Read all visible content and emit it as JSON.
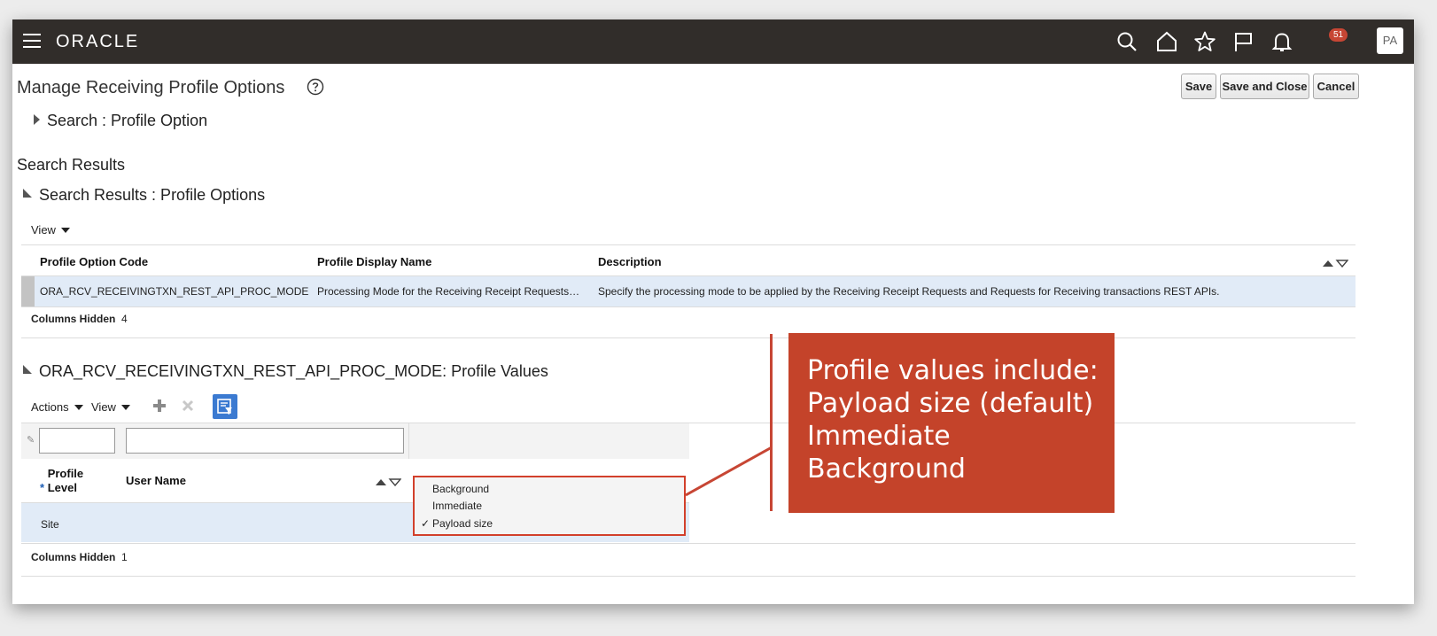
{
  "header": {
    "logo": "ORACLE",
    "notification_count": "51",
    "avatar_initials": "PA"
  },
  "page": {
    "title": "Manage Receiving Profile Options",
    "buttons": {
      "save": "Save",
      "save_close": "Save and Close",
      "cancel": "Cancel"
    },
    "search_section": "Search : Profile Option",
    "results_title": "Search Results",
    "results_subtitle": "Search Results : Profile Options"
  },
  "profile_table": {
    "view_label": "View",
    "columns": [
      "Profile Option Code",
      "Profile Display Name",
      "Description"
    ],
    "row": {
      "code": "ORA_RCV_RECEIVINGTXN_REST_API_PROC_MODE",
      "display_name": "Processing Mode for the Receiving Receipt Requests…",
      "description": "Specify the processing mode to be applied by the Receiving Receipt Requests and Requests for Receiving transactions REST APIs."
    },
    "columns_hidden_label": "Columns Hidden",
    "columns_hidden_count": "4"
  },
  "values_section": {
    "title": "ORA_RCV_RECEIVINGTXN_REST_API_PROC_MODE: Profile Values",
    "actions_label": "Actions",
    "view_label": "View",
    "columns": {
      "required_mark": "*",
      "profile_level": "Profile Level",
      "user_name": "User Name"
    },
    "row": {
      "profile_level": "Site"
    },
    "columns_hidden_label": "Columns Hidden",
    "columns_hidden_count": "1"
  },
  "dropdown": {
    "options": [
      "Background",
      "Immediate",
      "Payload size"
    ],
    "selected": "Payload size",
    "check": "✓"
  },
  "callout": {
    "lines": [
      "Profile values include:",
      "Payload size (default)",
      "Immediate",
      "Background"
    ]
  },
  "colors": {
    "header_bg": "#312d2a",
    "selected_row": "#e1ebf7",
    "callout": "#c4432a",
    "highlight_border": "#d2402b"
  }
}
